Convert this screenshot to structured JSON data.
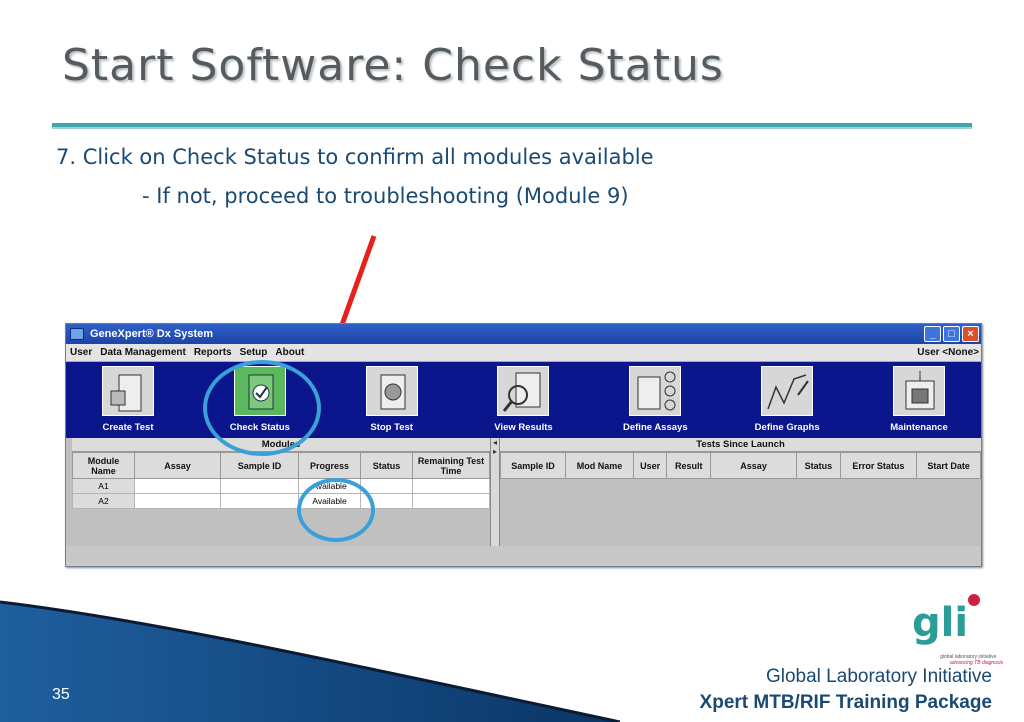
{
  "slide": {
    "title": "Start Software: Check Status",
    "line1": "7. Click on Check Status to confirm all modules available",
    "line2": "- If not, proceed to troubleshooting (Module 9)",
    "page_number": "35",
    "org": "Global Laboratory Initiative",
    "package": "Xpert MTB/RIF Training Package",
    "logo_text": "gli",
    "logo_tagline": "global laboratory initiative",
    "logo_tagline2": "advancing TB diagnosis",
    "accent_color": "#3fa6b0",
    "text_color": "#1a4a73"
  },
  "app": {
    "window_title": "GeneXpert® Dx System",
    "menu": [
      "User",
      "Data Management",
      "Reports",
      "Setup",
      "About"
    ],
    "user_label": "User <None>",
    "toolbar": [
      {
        "label": "Create Test",
        "icon": "create-test-icon"
      },
      {
        "label": "Check Status",
        "icon": "check-status-icon"
      },
      {
        "label": "Stop Test",
        "icon": "stop-test-icon"
      },
      {
        "label": "View Results",
        "icon": "view-results-icon"
      },
      {
        "label": "Define Assays",
        "icon": "define-assays-icon"
      },
      {
        "label": "Define Graphs",
        "icon": "define-graphs-icon"
      },
      {
        "label": "Maintenance",
        "icon": "maintenance-icon"
      }
    ],
    "modules_table": {
      "header": "Modules",
      "columns": [
        "Module Name",
        "Assay",
        "Sample ID",
        "Progress",
        "Status",
        "Remaining Test Time"
      ],
      "rows": [
        {
          "module": "A1",
          "assay": "",
          "sample_id": "",
          "progress": "Available",
          "status": "",
          "remaining": ""
        },
        {
          "module": "A2",
          "assay": "",
          "sample_id": "",
          "progress": "Available",
          "status": "",
          "remaining": ""
        }
      ]
    },
    "tests_table": {
      "header": "Tests Since Launch",
      "columns": [
        "Sample ID",
        "Mod Name",
        "User",
        "Result",
        "Assay",
        "Status",
        "Error Status",
        "Start Date"
      ]
    }
  }
}
